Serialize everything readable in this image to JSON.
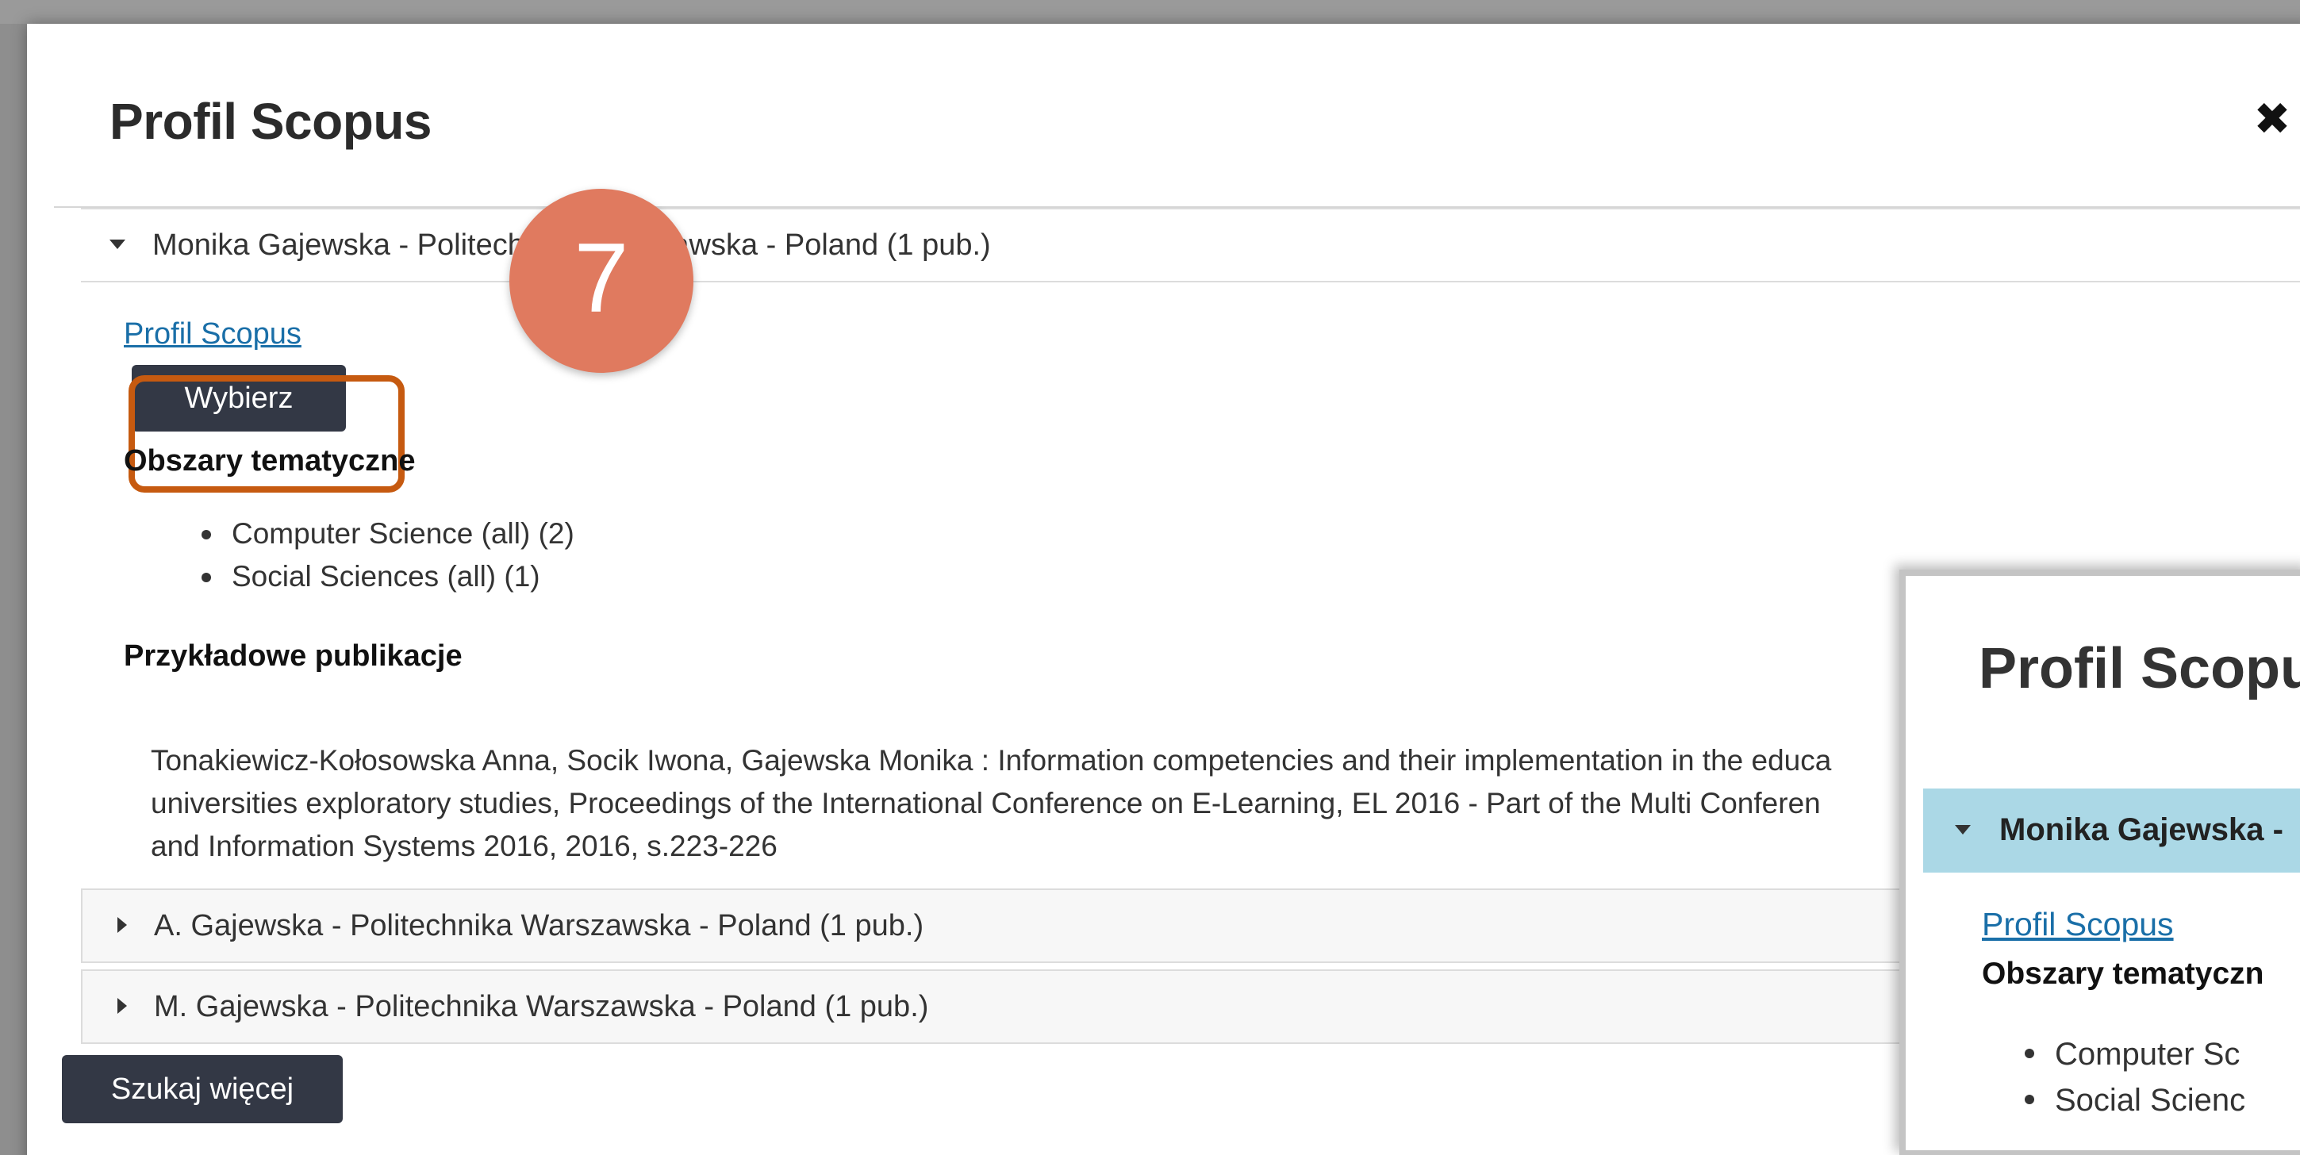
{
  "modal": {
    "title": "Profil Scopus",
    "close_symbol": "✖",
    "step_number": "7",
    "accordion": [
      {
        "label": "Monika Gajewska - Politechnika Warszawska - Poland (1 pub.)",
        "expanded": true,
        "profile_link": "Profil Scopus",
        "select_button": "Wybierz",
        "subject_areas_heading": "Obszary tematyczne",
        "subject_areas": [
          "Computer Science (all) (2)",
          "Social Sciences (all) (1)"
        ],
        "sample_pubs_heading": "Przykładowe publikacje",
        "publication_lines": [
          "Tonakiewicz-Kołosowska Anna, Socik Iwona, Gajewska Monika : Information competencies and their implementation in the educa",
          "universities exploratory studies, Proceedings of the International Conference on E-Learning, EL 2016 - Part of the Multi Conferen",
          "and Information Systems 2016, 2016, s.223-226"
        ]
      },
      {
        "label": "A. Gajewska - Politechnika Warszawska - Poland (1 pub.)",
        "expanded": false
      },
      {
        "label": "M. Gajewska - Politechnika Warszawska - Poland (1 pub.)",
        "expanded": false
      }
    ],
    "search_more_button": "Szukaj więcej"
  },
  "inset": {
    "title": "Profil Scopus",
    "header_label": "Monika Gajewska -",
    "profile_link": "Profil Scopus",
    "subject_areas_heading": "Obszary tematyczn",
    "subject_areas": [
      "Computer Sc",
      "Social Scienc"
    ]
  },
  "colors": {
    "button_bg": "#333845",
    "link": "#1a6fa8",
    "highlight_border": "#c65a10",
    "step_badge": "#e07a5f",
    "inset_header_bg": "#abd8e6"
  }
}
